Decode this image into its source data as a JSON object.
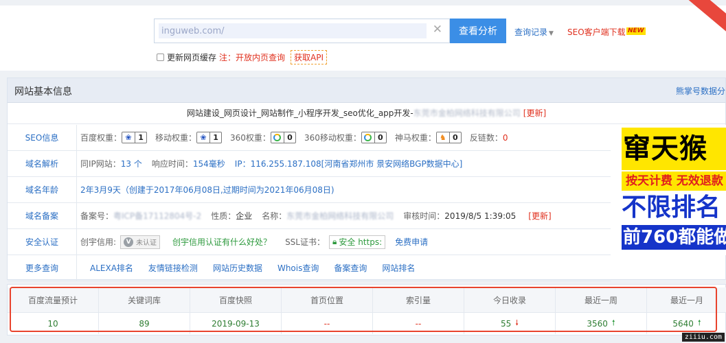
{
  "search": {
    "value": "inguweb.com/",
    "button_label": "查看分析",
    "history_label": "查询记录",
    "client_label": "SEO客户端下载",
    "new_badge": "NEW",
    "cache_label": "更新网页缓存",
    "note": "注：开放内页查询",
    "api_label": "获取API"
  },
  "panel": {
    "title": "网站基本信息",
    "right_link": "熊掌号数据分",
    "site_title": "网站建设_网页设计_网站制作_小程序开发_seo优化_app开发-",
    "site_company": "东莞市金柏网络科技有限公司",
    "site_update": "[更新]"
  },
  "seo": {
    "label": "SEO信息",
    "baidu_k": "百度权重：",
    "baidu_v": "1",
    "mobile_k": "移动权重：",
    "mobile_v": "1",
    "s360_k": "360权重：",
    "s360_v": "0",
    "s360m_k": "360移动权重：",
    "s360m_v": "0",
    "shenma_k": "神马权重：",
    "shenma_v": "0",
    "backlink_k": "反链数：",
    "backlink_v": "0"
  },
  "dns": {
    "label": "域名解析",
    "same_ip_k": "同IP网站：",
    "same_ip_v": "13 个",
    "resp_k": "响应时间：",
    "resp_v": "154毫秒",
    "ip": "IP：116.255.187.108[河南省郑州市 景安网络BGP数据中心]"
  },
  "age": {
    "label": "域名年龄",
    "text": "2年3月9天（创建于2017年06月08日,过期时间为2021年06月08日)"
  },
  "beian": {
    "label": "域名备案",
    "no_k": "备案号：",
    "no_v": "粤ICP备17112804号-2",
    "type_k": "性质：",
    "type_v": "企业",
    "name_k": "名称：",
    "name_v": "东莞市金柏网络科技有限公司",
    "time_k": "审核时间：",
    "time_v": "2019/8/5 1:39:05",
    "update": "[更新]"
  },
  "security": {
    "label": "安全认证",
    "credit_k": "创宇信用:",
    "credit_badge": "未认证",
    "credit_link": "创宇信用认证有什么好处？",
    "ssl_k": "SSL证书：",
    "ssl_badge": "安全 https:",
    "ssl_link": "免费申请"
  },
  "more": {
    "label": "更多查询",
    "links": [
      "ALEXA排名",
      "友情链接检测",
      "网站历史数据",
      "Whois查询",
      "备案查询",
      "网站排名"
    ]
  },
  "ad": {
    "line1": "窜天猴",
    "line2": "按天计费 无效退款",
    "line3": "不限排名",
    "line4": "前760都能做"
  },
  "stats": {
    "headers": [
      "百度流量预计",
      "关键词库",
      "百度快照",
      "首页位置",
      "索引量",
      "今日收录",
      "最近一周",
      "最近一月"
    ],
    "values": [
      "10",
      "89",
      "2019-09-13",
      "--",
      "--",
      "55",
      "3560",
      "5640"
    ]
  },
  "watermark": "ziiiu.com",
  "colors": {
    "accent": "#3b8ee6",
    "link": "#2b6fc4",
    "alert": "#e0301e",
    "highlight": "#e8432d"
  }
}
